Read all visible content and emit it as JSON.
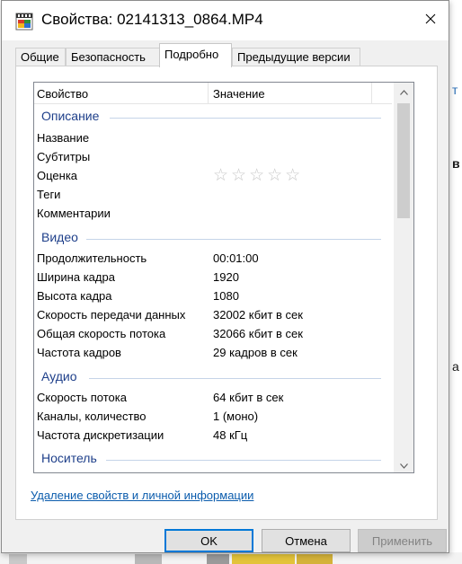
{
  "window": {
    "title": "Свойства: 02141313_0864.MP4",
    "icon": "video-file-icon",
    "close_icon": "close-icon"
  },
  "tabs": [
    {
      "label": "Общие",
      "active": false
    },
    {
      "label": "Безопасность",
      "active": false
    },
    {
      "label": "Подробно",
      "active": true
    },
    {
      "label": "Предыдущие версии",
      "active": false
    }
  ],
  "list": {
    "columns": {
      "property": "Свойство",
      "value": "Значение"
    },
    "groups": {
      "description": {
        "title": "Описание",
        "rows": [
          {
            "name": "Название",
            "value": ""
          },
          {
            "name": "Субтитры",
            "value": ""
          },
          {
            "name": "Оценка",
            "value": ""
          },
          {
            "name": "Теги",
            "value": ""
          },
          {
            "name": "Комментарии",
            "value": ""
          }
        ]
      },
      "video": {
        "title": "Видео",
        "rows": [
          {
            "name": "Продолжительность",
            "value": "00:01:00"
          },
          {
            "name": "Ширина кадра",
            "value": "1920"
          },
          {
            "name": "Высота кадра",
            "value": "1080"
          },
          {
            "name": "Скорость передачи данных",
            "value": "32002 кбит в сек"
          },
          {
            "name": "Общая скорость потока",
            "value": "32066 кбит в сек"
          },
          {
            "name": "Частота кадров",
            "value": "29 кадров в сек"
          }
        ]
      },
      "audio": {
        "title": "Аудио",
        "rows": [
          {
            "name": "Скорость потока",
            "value": "64 кбит в сек"
          },
          {
            "name": "Каналы, количество",
            "value": "1 (моно)"
          },
          {
            "name": "Частота дискретизации",
            "value": "48 кГц"
          }
        ]
      },
      "media": {
        "title": "Носитель"
      }
    },
    "rating": {
      "stars": "☆☆☆☆☆",
      "value": 0,
      "max": 5
    }
  },
  "remove_link": "Удаление свойств и личной информации",
  "buttons": {
    "ok": "OK",
    "cancel": "Отмена",
    "apply": "Применить"
  },
  "background": {
    "right_chars": [
      "т",
      "в",
      "а"
    ]
  },
  "colors": {
    "accent": "#0078d7",
    "group_title": "#1e3f8a",
    "link": "#0b5cad"
  }
}
